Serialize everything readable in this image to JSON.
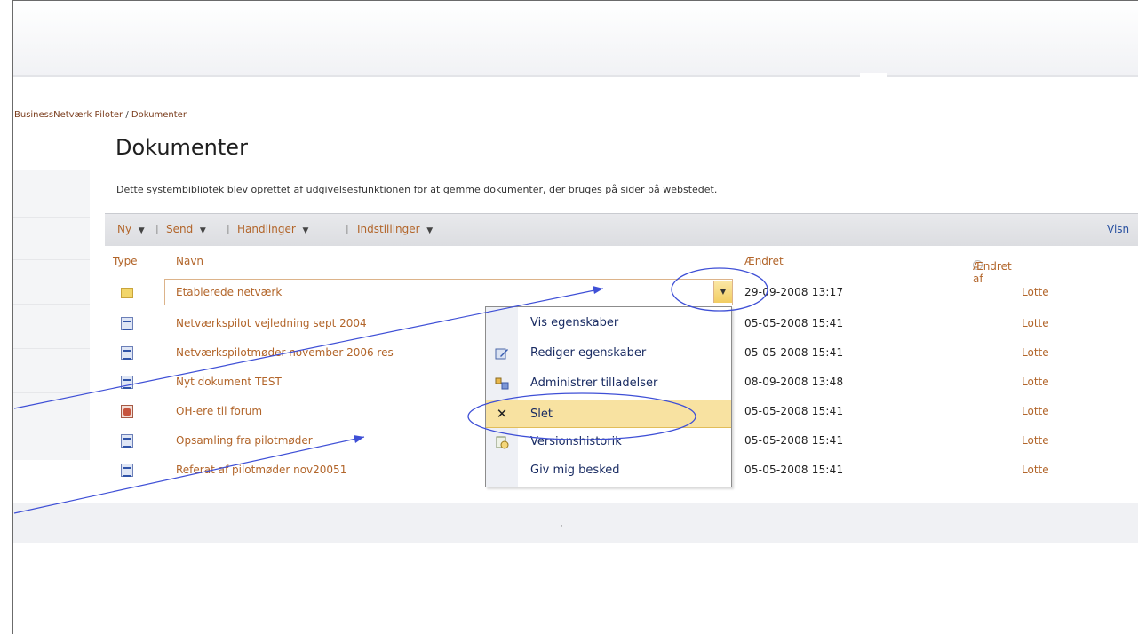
{
  "breadcrumb": {
    "parent": "BusinessNetværk Piloter",
    "separator": "/",
    "current": "Dokumenter"
  },
  "page_title": "Dokumenter",
  "description": "Dette systembibliotek blev oprettet af udgivelsesfunktionen for at gemme dokumenter, der bruges på sider på webstedet.",
  "toolbar": {
    "new_label": "Ny",
    "send_label": "Send",
    "actions_label": "Handlinger",
    "settings_label": "Indstillinger",
    "view_label": "Visn",
    "dropdown_arrow": "▼",
    "separator": "|"
  },
  "columns": {
    "type": "Type",
    "name": "Navn",
    "modified": "Ændret",
    "modified_by": "Ændret af"
  },
  "rows": [
    {
      "icon": "folder-icon",
      "name": "Etablerede netværk",
      "modified": "29-09-2008 13:17",
      "author": "Lotte"
    },
    {
      "icon": "word-doc-icon",
      "name": "Netværkspilot vejledning sept 2004",
      "modified": "05-05-2008 15:41",
      "author": "Lotte"
    },
    {
      "icon": "word-doc-icon",
      "name": "Netværkspilotmøder november 2006 res",
      "modified": "05-05-2008 15:41",
      "author": "Lotte"
    },
    {
      "icon": "word-doc-icon",
      "name": "Nyt dokument TEST",
      "modified": "08-09-2008 13:48",
      "author": "Lotte"
    },
    {
      "icon": "powerpoint-icon",
      "name": "OH-ere til forum",
      "modified": "05-05-2008 15:41",
      "author": "Lotte"
    },
    {
      "icon": "word-doc-icon",
      "name": "Opsamling fra pilotmøder",
      "modified": "05-05-2008 15:41",
      "author": "Lotte"
    },
    {
      "icon": "word-doc-icon",
      "name": "Referat af pilotmøder nov20051",
      "modified": "05-05-2008 15:41",
      "author": "Lotte"
    }
  ],
  "context_menu": {
    "items": [
      {
        "label": "Vis egenskaber",
        "icon": ""
      },
      {
        "label": "Rediger egenskaber",
        "icon": "edit-properties-icon"
      },
      {
        "label": "Administrer tilladelser",
        "icon": "permissions-icon"
      },
      {
        "label": "Slet",
        "icon": "delete-x-icon",
        "x_glyph": "✕"
      },
      {
        "label": "Versionshistorik",
        "icon": "version-history-icon"
      },
      {
        "label": "Giv mig besked",
        "icon": ""
      }
    ],
    "highlighted": "Slet"
  },
  "colors": {
    "link": "#b2652a",
    "annotation": "#3e4fd6",
    "menu_highlight": "#f8e2a1"
  }
}
